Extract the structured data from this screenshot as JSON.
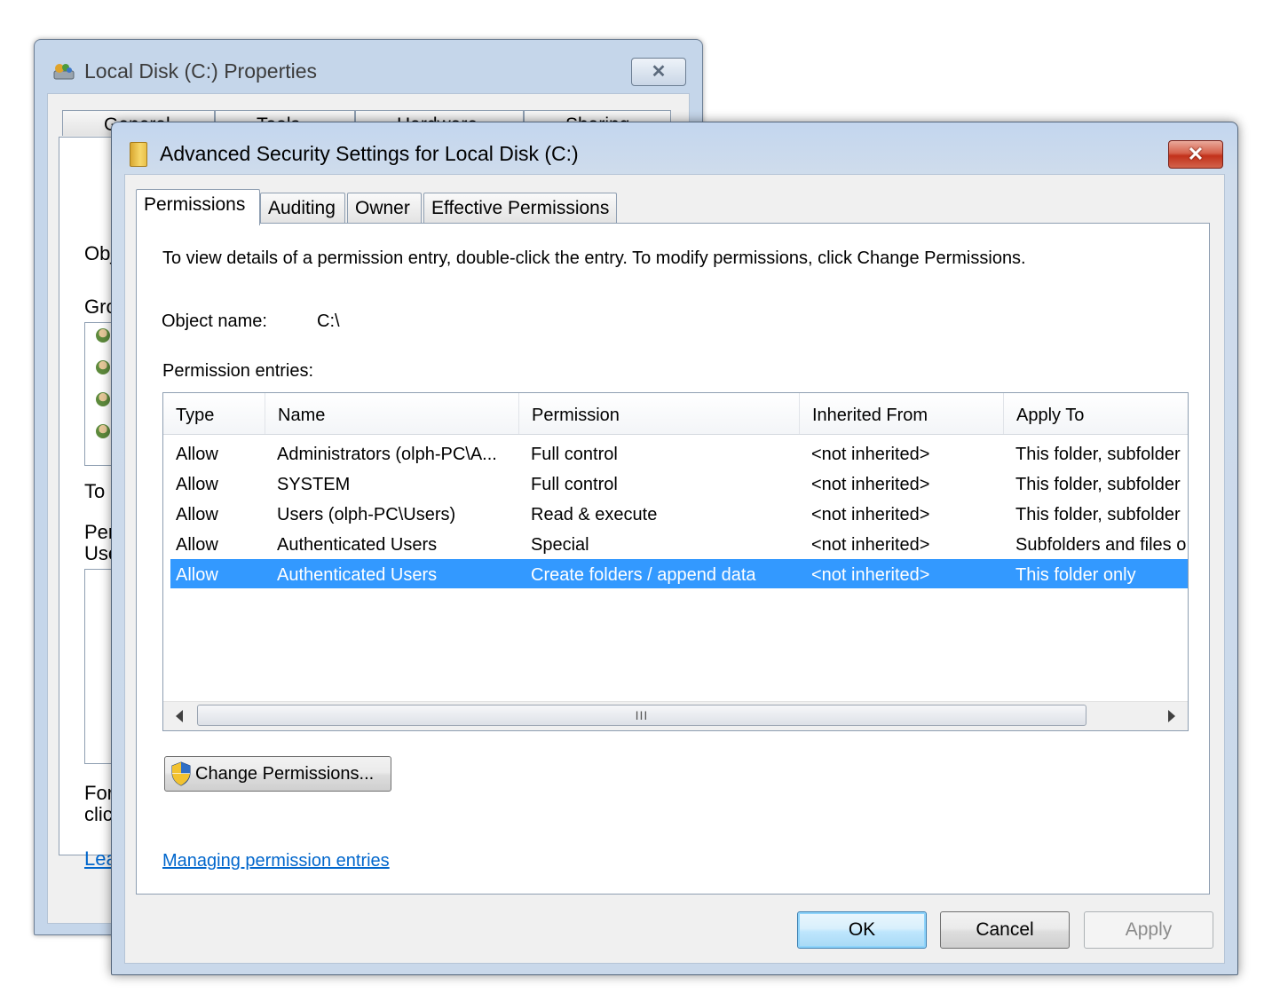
{
  "background_window": {
    "title": "Local Disk (C:) Properties",
    "close_glyph": "✕",
    "tabs": [
      "General",
      "Tools",
      "Hardware",
      "Sharing"
    ],
    "fragments": {
      "obj": "Obj",
      "gro": "Gro",
      "to": "To",
      "per": "Per",
      "use": "Use",
      "for": "For",
      "clic": "clic",
      "lea": "Lea"
    }
  },
  "dialog": {
    "title": "Advanced Security Settings for Local Disk (C:)",
    "close_glyph": "✕",
    "tabs": [
      {
        "label": "Permissions",
        "active": true
      },
      {
        "label": "Auditing",
        "active": false
      },
      {
        "label": "Owner",
        "active": false
      },
      {
        "label": "Effective Permissions",
        "active": false
      }
    ],
    "instructions": "To view details of a permission entry, double-click the entry. To modify permissions, click Change Permissions.",
    "object_name_label": "Object name:",
    "object_name_value": "C:\\",
    "permission_entries_label": "Permission entries:",
    "columns": [
      "Type",
      "Name",
      "Permission",
      "Inherited From",
      "Apply To"
    ],
    "rows": [
      {
        "type": "Allow",
        "name": "Administrators (olph-PC\\A...",
        "permission": "Full control",
        "inherited": "<not inherited>",
        "apply": "This folder, subfolder"
      },
      {
        "type": "Allow",
        "name": "SYSTEM",
        "permission": "Full control",
        "inherited": "<not inherited>",
        "apply": "This folder, subfolder"
      },
      {
        "type": "Allow",
        "name": "Users (olph-PC\\Users)",
        "permission": "Read & execute",
        "inherited": "<not inherited>",
        "apply": "This folder, subfolder"
      },
      {
        "type": "Allow",
        "name": "Authenticated Users",
        "permission": "Special",
        "inherited": "<not inherited>",
        "apply": "Subfolders and files o"
      },
      {
        "type": "Allow",
        "name": "Authenticated Users",
        "permission": "Create folders / append data",
        "inherited": "<not inherited>",
        "apply": "This folder only",
        "selected": true
      }
    ],
    "scroll_thumb_grip": "III",
    "change_permissions_label": "Change Permissions...",
    "managing_link": "Managing permission entries",
    "buttons": {
      "ok": "OK",
      "cancel": "Cancel",
      "apply": "Apply"
    }
  },
  "colors": {
    "selection": "#3399ff",
    "link": "#0066cc",
    "close_red": "#c2311b"
  }
}
